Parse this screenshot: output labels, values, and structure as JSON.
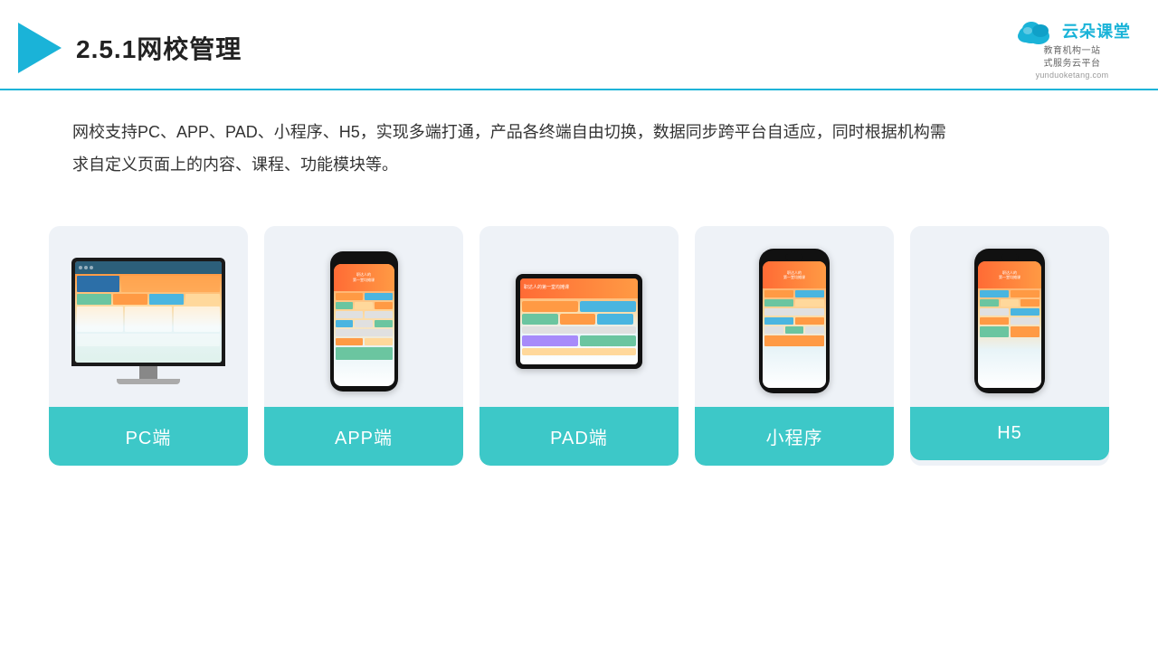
{
  "header": {
    "title_prefix": "2.5.1",
    "title_main": "网校管理",
    "logo_main": "云朵课堂",
    "logo_url": "yunduoketang.com",
    "logo_tagline": "教育机构一站\n式服务云平台"
  },
  "description": {
    "text": "网校支持PC、APP、PAD、小程序、H5，实现多端打通，产品各终端自由切换，数据同步跨平台自适应，同时根据机构需求自定义页面上的内容、课程、功能模块等。"
  },
  "cards": [
    {
      "id": "pc",
      "label": "PC端"
    },
    {
      "id": "app",
      "label": "APP端"
    },
    {
      "id": "pad",
      "label": "PAD端"
    },
    {
      "id": "miniprogram",
      "label": "小程序"
    },
    {
      "id": "h5",
      "label": "H5"
    }
  ],
  "colors": {
    "accent": "#1ab3d8",
    "card_label_bg": "#3dc8c8",
    "card_bg": "#eef2f7",
    "screen_orange": "#ff8c42",
    "screen_teal": "#4ab5e0",
    "screen_green": "#6bc5a0"
  }
}
